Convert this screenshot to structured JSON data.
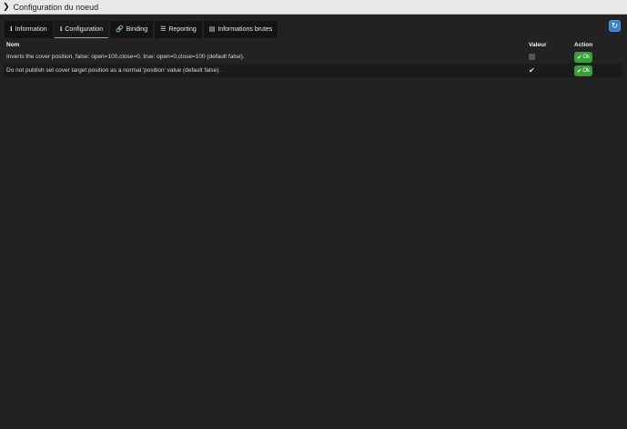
{
  "window": {
    "title": "Configuration du noeud"
  },
  "tabs": [
    {
      "label": "Information",
      "icon": "info-icon",
      "glyph": "ℹ",
      "active": false
    },
    {
      "label": "Configuration",
      "icon": "info-icon",
      "glyph": "ℹ",
      "active": true
    },
    {
      "label": "Binding",
      "icon": "link-icon",
      "glyph": "🔗",
      "active": false
    },
    {
      "label": "Reporting",
      "icon": "list-icon",
      "glyph": "☰",
      "active": false
    },
    {
      "label": "Informations brutes",
      "icon": "newspaper-icon",
      "glyph": "▤",
      "active": false
    }
  ],
  "table": {
    "headers": {
      "name": "Nom",
      "value": "Valeur",
      "action": "Action"
    },
    "rows": [
      {
        "name": "Inverts the cover position, false: open=100,close=0, true: open=0,close=100 (default false).",
        "checked": false,
        "action": "Ok"
      },
      {
        "name": "Do not publish set cover target position as a normal 'position' value (default false).",
        "checked": true,
        "action": "Ok"
      }
    ]
  },
  "colors": {
    "background": "#222222",
    "titlebar": "#e8e8e8",
    "ok_button": "#3c9d3c",
    "refresh_button": "#3b7fc4",
    "active_tab_underline": "#9ab83a"
  }
}
